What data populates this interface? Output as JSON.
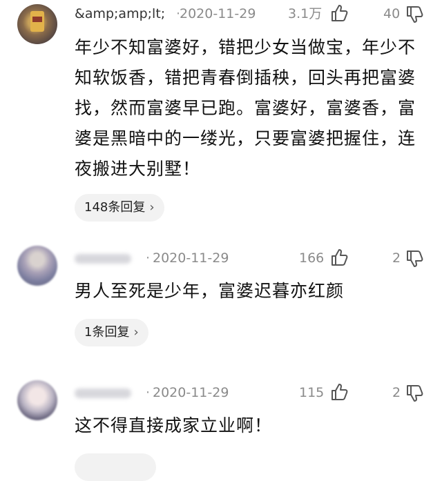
{
  "comments": [
    {
      "username": "&amp;amp;lt;",
      "date": "2020-11-29",
      "likes": "3.1万",
      "dislikes": "40",
      "text": "年少不知富婆好，错把少女当做宝，年少不知软饭香，错把青春倒插秧，回头再把富婆找，然而富婆早已跑。富婆好，富婆香，富婆是黑暗中的一缕光，只要富婆把握住，连夜搬进大别墅！",
      "replies": "148条回复"
    },
    {
      "username": "",
      "date": "2020-11-29",
      "likes": "166",
      "dislikes": "2",
      "text": "男人至死是少年，富婆迟暮亦红颜",
      "replies": "1条回复"
    },
    {
      "username": "",
      "date": "2020-11-29",
      "likes": "115",
      "dislikes": "2",
      "text": "这不得直接成家立业啊！",
      "replies": ""
    }
  ],
  "icons": {
    "like": "thumbs-up-icon",
    "dislike": "thumbs-down-icon",
    "chevron": "chevron-right-icon"
  },
  "chevron_glyph": "›",
  "dot_separator": "·"
}
